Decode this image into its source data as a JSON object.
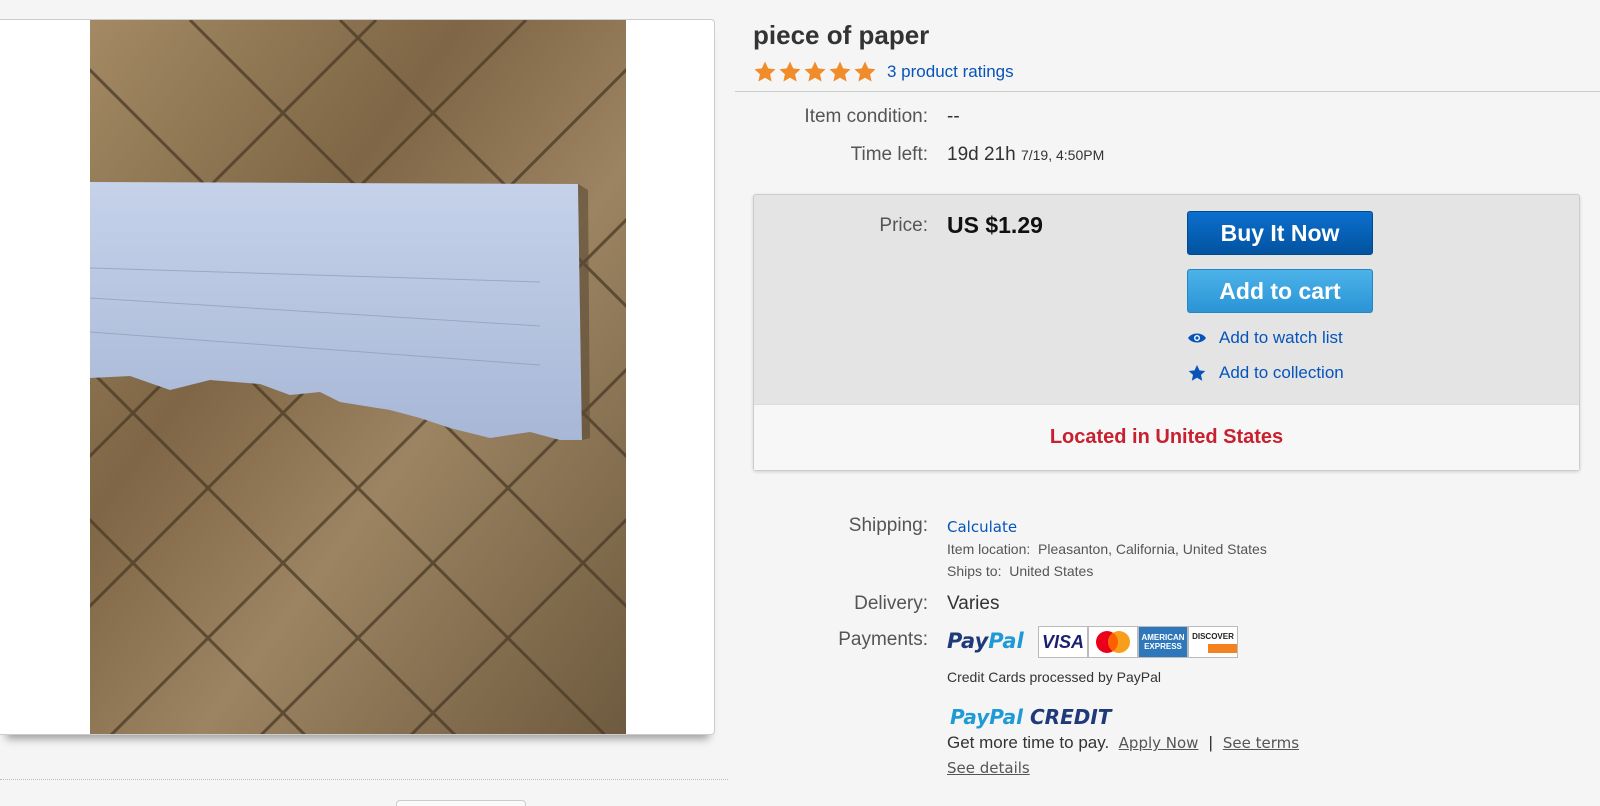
{
  "item": {
    "title": "piece of paper",
    "rating_stars": 5,
    "ratings_link": "3 product ratings"
  },
  "details": {
    "condition_label": "Item condition:",
    "condition_value": "--",
    "time_left_label": "Time left:",
    "time_left_value": "19d 21h",
    "time_left_end": "7/19, 4:50PM"
  },
  "buy_box": {
    "price_label": "Price:",
    "price_value": "US $1.29",
    "buy_now_label": "Buy It Now",
    "add_to_cart_label": "Add to cart",
    "watch_list_label": "Add to watch list",
    "collection_label": "Add to collection",
    "location_text": "Located in United States"
  },
  "shipping": {
    "label": "Shipping:",
    "calculate_link": "Calculate",
    "item_location_label": "Item location:",
    "item_location_value": "Pleasanton, California, United States",
    "ships_to_label": "Ships to:",
    "ships_to_value": "United States"
  },
  "delivery": {
    "label": "Delivery:",
    "value": "Varies"
  },
  "payments": {
    "label": "Payments:",
    "paypal_part1": "Pay",
    "paypal_part2": "Pal",
    "cards": {
      "visa": "VISA",
      "amex_line1": "AMERICAN",
      "amex_line2": "EXPRESS",
      "discover": "DISCOVER"
    },
    "processed_note": "Credit Cards processed by PayPal",
    "credit_part1": "PayPal",
    "credit_part2": "CREDIT",
    "credit_pitch": "Get more time to pay.",
    "apply_now_link": "Apply Now",
    "separator": "|",
    "see_terms_link": "See terms",
    "see_details_link": "See details"
  },
  "colors": {
    "link": "#0654ba",
    "star": "#f18c2b",
    "location_red": "#c8202f",
    "buy_now_blue": "#0b6fce",
    "add_cart_blue": "#2a94d6"
  }
}
